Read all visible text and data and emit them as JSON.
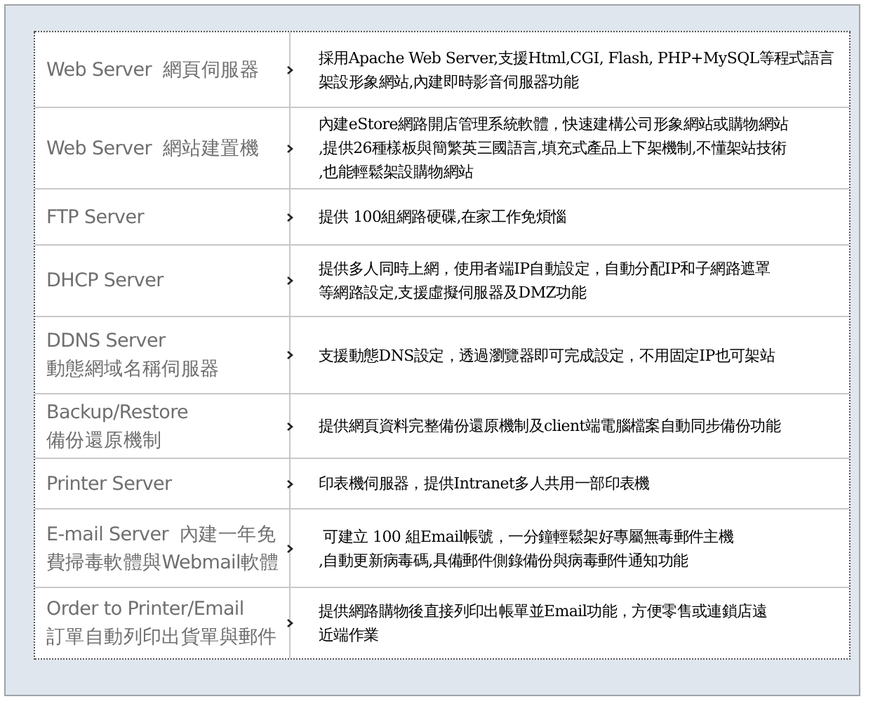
{
  "features": [
    {
      "name": [
        "Web Server  網頁伺服器"
      ],
      "description": [
        "採用Apache Web Server,支援Html,CGI, Flash, PHP+MySQL等程式語言",
        "架設形象網站,內建即時影音伺服器功能"
      ]
    },
    {
      "name": [
        "Web Server  網站建置機"
      ],
      "description": [
        "內建eStore網路開店管理系統軟體，快速建構公司形象網站或購物網站",
        ",提供26種樣板與簡繁英三國語言,填充式產品上下架機制,不懂架站技術",
        ",也能輕鬆架設購物網站"
      ]
    },
    {
      "name": [
        "FTP Server"
      ],
      "description": [
        "提供 100組網路硬碟,在家工作免煩惱"
      ]
    },
    {
      "name": [
        "DHCP Server"
      ],
      "description": [
        "提供多人同時上網，使用者端IP自動設定，自動分配IP和子網路遮罩",
        "等網路設定,支援虛擬伺服器及DMZ功能"
      ]
    },
    {
      "name": [
        "DDNS Server",
        "動態網域名稱伺服器"
      ],
      "description": [
        "支援動態DNS設定，透過瀏覽器即可完成設定，不用固定IP也可架站"
      ]
    },
    {
      "name": [
        "Backup/Restore",
        "備份還原機制"
      ],
      "description": [
        "提供網頁資料完整備份還原機制及client端電腦檔案自動同步備份功能"
      ]
    },
    {
      "name": [
        "Printer Server"
      ],
      "description": [
        "印表機伺服器，提供Intranet多人共用一部印表機"
      ]
    },
    {
      "name": [
        "E-mail Server  內建一年免",
        "費掃毒軟體與Webmail軟體"
      ],
      "description": [
        " 可建立 100 組Email帳號，一分鐘輕鬆架好專屬無毒郵件主機",
        ",自動更新病毒碼,具備郵件側錄備份與病毒郵件通知功能"
      ]
    },
    {
      "name": [
        "Order to Printer/Email",
        "訂單自動列印出貨單與郵件"
      ],
      "description": [
        "提供網路購物後直接列印出帳單並Email功能，方便零售或連鎖店遠",
        "近端作業"
      ]
    }
  ]
}
